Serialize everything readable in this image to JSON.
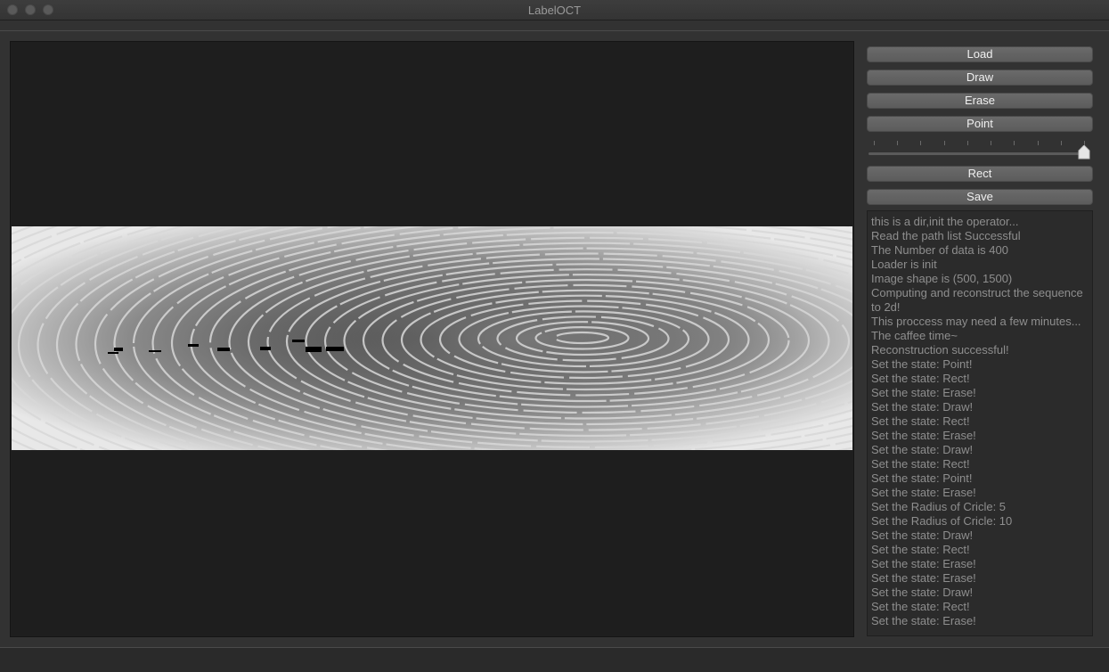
{
  "window": {
    "title": "LabelOCT"
  },
  "buttons": {
    "load": "Load",
    "draw": "Draw",
    "erase": "Erase",
    "point": "Point",
    "rect": "Rect",
    "save": "Save"
  },
  "radius_slider": {
    "ticks": 10,
    "value_fraction": 1.0
  },
  "log_lines": [
    "this is a dir,init the operator...",
    "Read the path list Successful",
    "The Number of data is 400",
    "Loader is init",
    "Image shape is (500, 1500)",
    "Computing and reconstruct the sequence to 2d!",
    "This proccess may need a few minutes...",
    "The caffee time~",
    "Reconstruction successful!",
    "Set the state: Point!",
    "Set the state: Rect!",
    "Set the state: Erase!",
    "Set the state: Draw!",
    "Set the state: Rect!",
    "Set the state: Erase!",
    "Set the state: Draw!",
    "Set the state: Rect!",
    "Set the state: Point!",
    "Set the state: Erase!",
    "Set the Radius of Cricle: 5",
    "Set the Radius of Cricle: 10",
    "Set the state: Draw!",
    "Set the state: Rect!",
    "Set the state: Erase!",
    "Set the state: Erase!",
    "Set the state: Draw!",
    "Set the state: Rect!",
    "Set the state: Erase!"
  ],
  "colors": {
    "background": "#323232",
    "canvas": "#1e1e1e",
    "button": "#616161",
    "log_text": "#8e8e8e"
  }
}
